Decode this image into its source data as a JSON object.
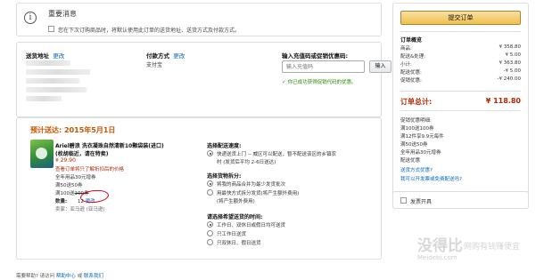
{
  "notice": {
    "title": "重要消息",
    "checkbox_label": "您在下次订购商品时，将默认使用此订单的送货地址、送货方式及付款方式。"
  },
  "address": {
    "heading": "送货地址",
    "change": "更改"
  },
  "payment": {
    "heading": "付款方式",
    "change": "更改",
    "value": "支付宝"
  },
  "promo": {
    "heading": "输入充值码或促销优惠码:",
    "placeholder": "输入充值码",
    "button": "输入",
    "success": "你已成功获得促销代码的优惠。"
  },
  "shipment": {
    "delivery_label": "预计送达:",
    "delivery_date": "2015年5月1日",
    "product": {
      "title_line1": "Ariel碧浪 洗衣凝珠自然清新10颗袋装(进口)",
      "title_line2": "(枚胡临近，请在特卖)",
      "price": "¥ 29.90",
      "warning": "查看订单将只了解折扣后的价格",
      "promo1": "全年用品30元增券",
      "promo2": "满50送50券",
      "promo3_prefix": "满100送",
      "promo3_strike": "100券",
      "qty_label": "数量:",
      "qty_value": "12",
      "qty_change": "更改",
      "seller": "卖家：亚马逊 (亚马逊)"
    },
    "speed": {
      "heading": "选择配送速度:",
      "option_line1": "快递送货上门 -- 威区可以配送，暂不配送该区的乡镇农",
      "option_line2": "村 (发货后平均 2-6日送达)"
    },
    "split": {
      "heading": "选择货物拆分:",
      "option1": "将我的商品合并为最少发货批次",
      "option2_line1": "用最快方式拆分发货(将产生额外费用)",
      "option2_line2": "(将产生额外费用)"
    },
    "time": {
      "heading": "请选择希望送货的时间:",
      "option1": "工作日、双休日或假日均可送货",
      "option2": "只工作日送货",
      "option3": "只双休日、假日送货"
    }
  },
  "footer": {
    "text_prefix": "需要帮助? 请访问",
    "link1": "帮助中心",
    "mid": "或",
    "link2": "联系我们"
  },
  "summary": {
    "place_order": "提交订单",
    "heading": "订单概览",
    "rows": [
      {
        "label": "商品:",
        "value": "¥ 358.80"
      },
      {
        "label": "配送&处理:",
        "value": "¥ 5.00"
      },
      {
        "label": "小计:",
        "value": "¥ 363.80"
      },
      {
        "label": "配送优惠:",
        "value": "-¥ 5.00"
      },
      {
        "label": "促销优惠:",
        "value": "-¥ 240.00"
      }
    ],
    "total_label": "订单总计:",
    "total_value": "¥ 118.80",
    "promo_heading": "促销优惠明细:",
    "promos": [
      "满100送100券",
      "满12件享9.9元每件",
      "满50送50券",
      "全年用品30元增券",
      "配送优惠"
    ],
    "link1": "送货方式优惠?",
    "link2": "我可以开发票或免费配送吗?",
    "gift_label": "发票开具"
  },
  "watermark": {
    "brand": "没得比",
    "sub": "Meidebi.com",
    "slogan": "网购有钱赚便宜"
  }
}
